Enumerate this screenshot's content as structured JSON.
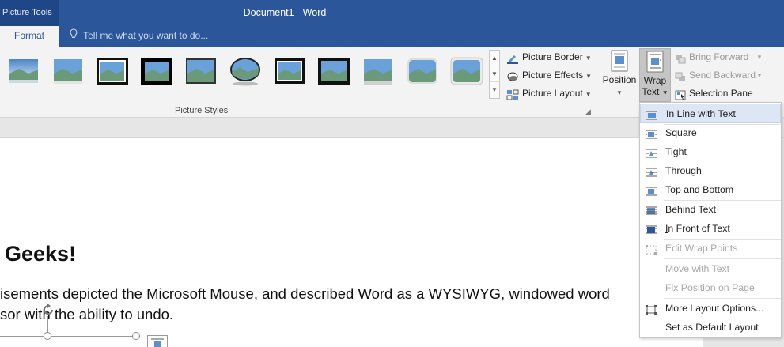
{
  "titlebar": {
    "context_tools": "Picture Tools",
    "doc_title": "Document1 - Word"
  },
  "tabs": {
    "format": "Format",
    "tell_me": "Tell me what you want to do..."
  },
  "ribbon": {
    "picture_styles_label": "Picture Styles",
    "picture_border": "Picture Border",
    "picture_effects": "Picture Effects",
    "picture_layout": "Picture Layout",
    "position": "Position",
    "wrap_text_line1": "Wrap",
    "wrap_text_line2": "Text",
    "bring_forward": "Bring Forward",
    "send_backward": "Send Backward",
    "selection_pane": "Selection Pane"
  },
  "document": {
    "heading": "Geeks!",
    "line1": "isements depicted the Microsoft Mouse, and described Word as a WYSIWYG, windowed word",
    "line2": "sor with the ability to undo."
  },
  "wrap_menu": {
    "in_line": "In Line with Text",
    "square": "Square",
    "tight": "Tight",
    "through": "Through",
    "top_bottom": "Top and Bottom",
    "behind": "Behind Text",
    "in_front": "In Front of Text",
    "edit_wrap": "Edit Wrap Points",
    "move_with": "Move with Text",
    "fix_position": "Fix Position on Page",
    "more_layout": "More Layout Options...",
    "set_default": "Set as Default Layout"
  },
  "colors": {
    "title_blue": "#2b579a",
    "ribbon_bg": "#f3f3f3",
    "menu_hover": "#dce6f4"
  }
}
